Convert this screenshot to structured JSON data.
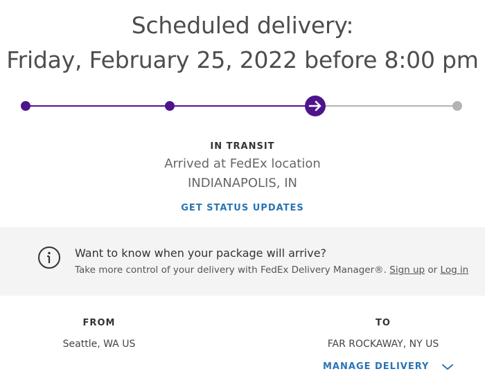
{
  "schedule": {
    "title": "Scheduled delivery:",
    "date": "Friday, February 25, 2022 before 8:00 pm"
  },
  "progress": {
    "steps": 4,
    "current_step": 3,
    "active_color": "#4d148c",
    "inactive_color": "#b3b3b3",
    "current_icon": "arrow-right-icon"
  },
  "status": {
    "label": "IN TRANSIT",
    "detail": "Arrived at FedEx location",
    "location": "INDIANAPOLIS, IN",
    "updates_link": "GET STATUS UPDATES"
  },
  "info_banner": {
    "icon": "info-icon",
    "title": "Want to know when your package will arrive?",
    "text_prefix": "Take more control of your delivery with FedEx Delivery Manager®. ",
    "signup_link": "Sign up",
    "text_or": " or ",
    "login_link": "Log in"
  },
  "shipment": {
    "from_label": "FROM",
    "from_value": "Seattle, WA US",
    "to_label": "TO",
    "to_value": "FAR ROCKAWAY, NY US",
    "manage_link": "MANAGE DELIVERY",
    "manage_icon": "chevron-down-icon"
  },
  "colors": {
    "link": "#2a74b5",
    "purple": "#4d148c",
    "band": "#f4f4f4"
  }
}
